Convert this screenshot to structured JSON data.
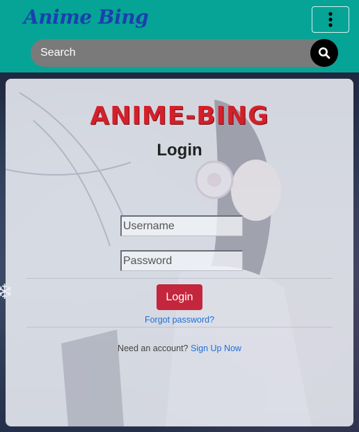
{
  "navbar": {
    "brand": "Anime Bing",
    "menu_icon": "vertical-dots-icon",
    "search": {
      "placeholder": "Search",
      "icon": "search-icon"
    }
  },
  "login_card": {
    "logo": "ANIME-BING",
    "title": "Login",
    "username": {
      "placeholder": "Username",
      "value": ""
    },
    "password": {
      "placeholder": "Password",
      "value": ""
    },
    "login_button": "Login",
    "forgot_link": "Forgot password?",
    "signup_prompt": "Need an account?",
    "signup_link": "Sign Up Now"
  },
  "colors": {
    "navbar": "#05a496",
    "brand": "#1b3fb0",
    "logo": "#d3202a",
    "login_button": "#c3263d",
    "link": "#1e6fd9"
  }
}
